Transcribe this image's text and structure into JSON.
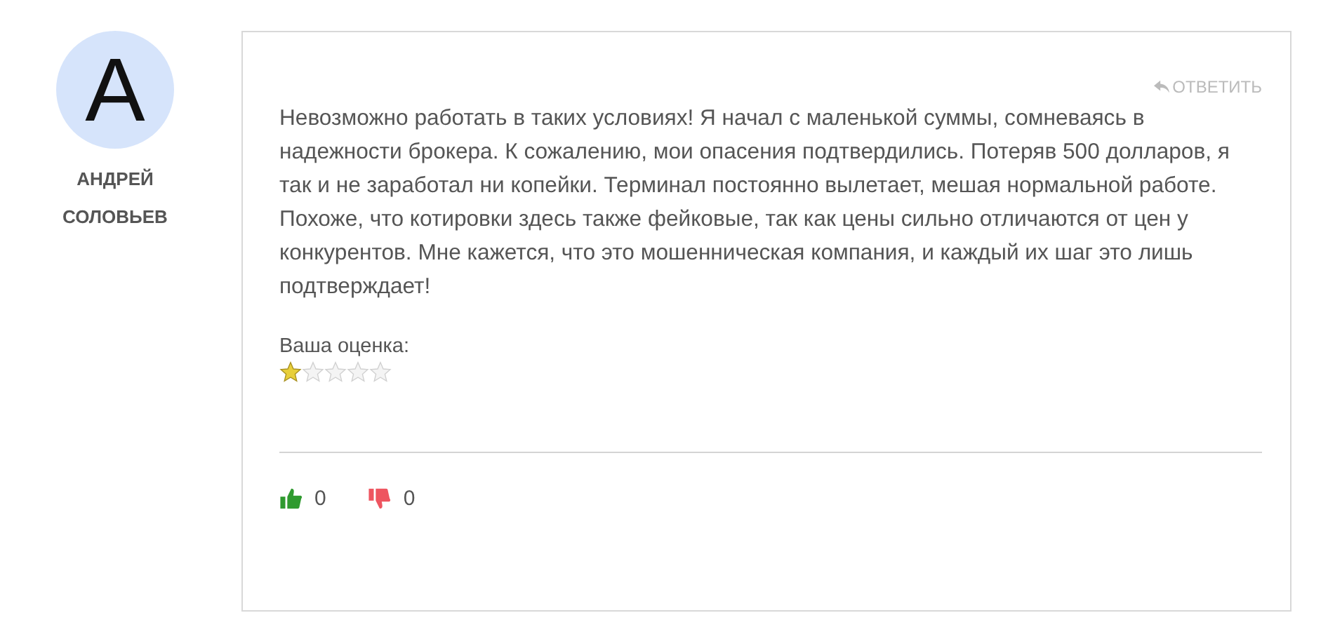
{
  "author": {
    "initial": "А",
    "name": "АНДРЕЙ СОЛОВЬЕВ"
  },
  "review": {
    "reply": "ОТВЕТИТЬ",
    "text": "Невозможно работать в таких условиях! Я начал с маленькой суммы, сомневаясь в надежности брокера. К сожалению, мои опасения подтвердились. Потеряв 500 долларов, я так и не заработал ни копейки. Терминал постоянно вылетает, мешая нормальной работе. Похоже, что котировки здесь также фейковые, так как цены сильно отличаются от цен у конкурентов. Мне кажется, что это мошенническая компания, и каждый их шаг это лишь подтверждает!",
    "rating_label": "Ваша оценка:",
    "stars": 1
  },
  "votes": [
    {
      "kind": "like",
      "count": "0"
    },
    {
      "kind": "dislike",
      "count": "0"
    }
  ]
}
